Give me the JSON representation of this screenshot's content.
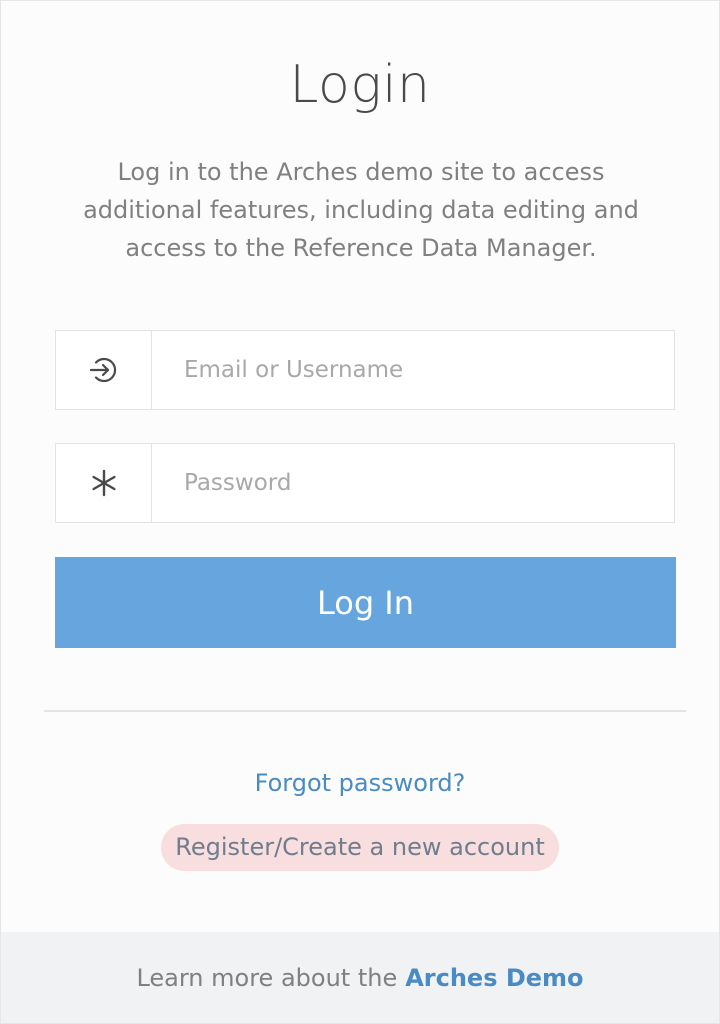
{
  "login": {
    "title": "Login",
    "description": "Log in to the Arches demo site to access additional features, including data editing and access to the Reference Data Manager.",
    "username": {
      "placeholder": "Email or Username",
      "value": "",
      "icon": "sign-in-icon"
    },
    "password": {
      "placeholder": "Password",
      "value": "",
      "icon": "asterisk-icon"
    },
    "submit_label": "Log In"
  },
  "links": {
    "forgot": "Forgot password?",
    "register": "Register/Create a new account"
  },
  "footer": {
    "text": "Learn more about the",
    "link": "Arches Demo"
  },
  "colors": {
    "accent": "#66a5de",
    "link": "#4a8bc3",
    "register_bg": "#f8dede"
  }
}
